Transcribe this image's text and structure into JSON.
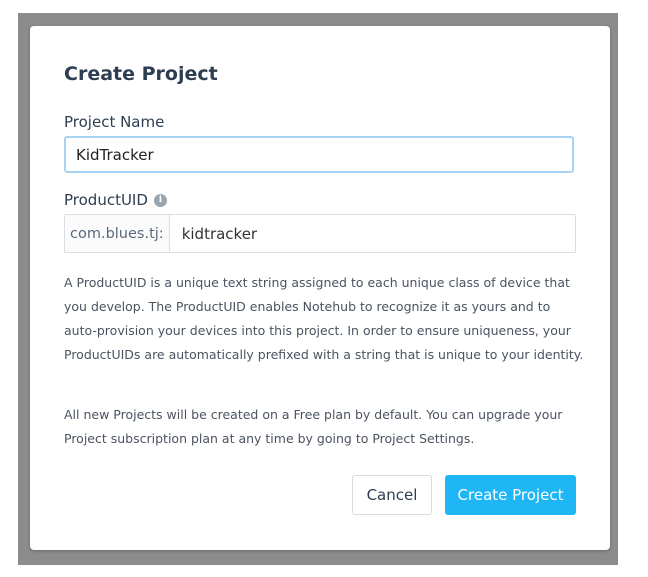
{
  "dialog": {
    "title": "Create Project",
    "project_name": {
      "label": "Project Name",
      "value": "KidTracker"
    },
    "product_uid": {
      "label": "ProductUID",
      "info_icon": "info-icon",
      "prefix": "com.blues.tj:",
      "value": "kidtracker"
    },
    "description_1": "A ProductUID is a unique text string assigned to each unique class of device that you develop. The ProductUID enables Notehub to recognize it as yours and to auto-provision your devices into this project. In order to ensure uniqueness, your ProductUIDs are automatically prefixed with a string that is unique to your identity.",
    "description_2": "All new Projects will be created on a Free plan by default. You can upgrade your Project subscription plan at any time by going to Project Settings.",
    "buttons": {
      "cancel": "Cancel",
      "create": "Create Project"
    }
  },
  "colors": {
    "accent": "#1fb6f5",
    "title_text": "#2d3e50",
    "focus_border": "#a9d3f3"
  }
}
